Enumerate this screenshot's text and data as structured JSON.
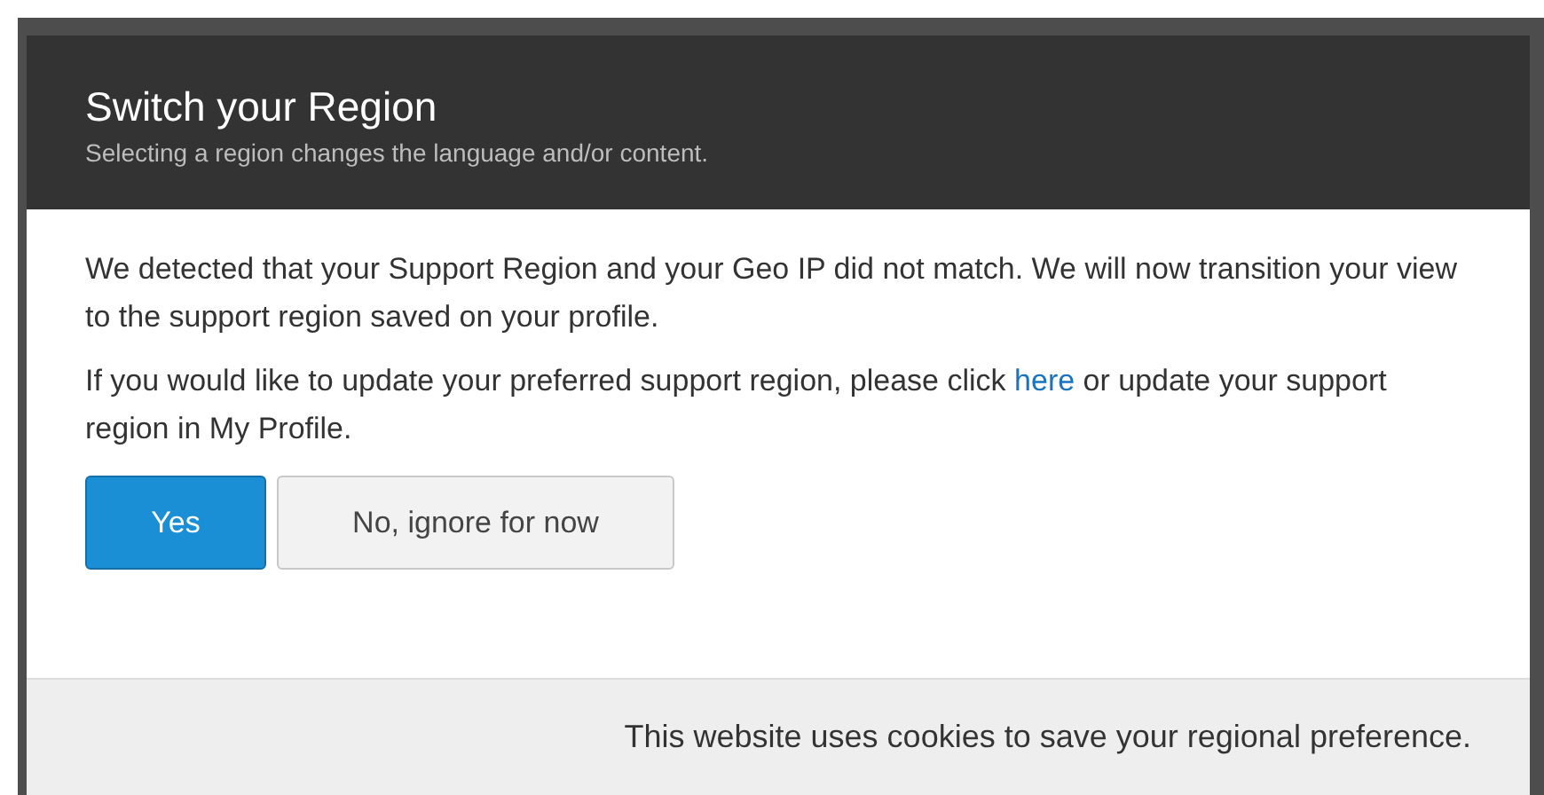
{
  "dialog": {
    "title": "Switch your Region",
    "subtitle": "Selecting a region changes the language and/or content.",
    "message": "We detected that your Support Region and your Geo IP did not match. We will now transition your view to the support region saved on your profile.",
    "update_text_before": "If you would like to update your preferred support region, please click",
    "update_link": "here",
    "update_text_after": "or update your support region in My Profile.",
    "buttons": [
      {
        "label": "Yes",
        "kind": "primary"
      },
      {
        "label": "No, ignore for now",
        "kind": "secondary"
      }
    ],
    "footer": "This website uses cookies to save your regional preference."
  }
}
